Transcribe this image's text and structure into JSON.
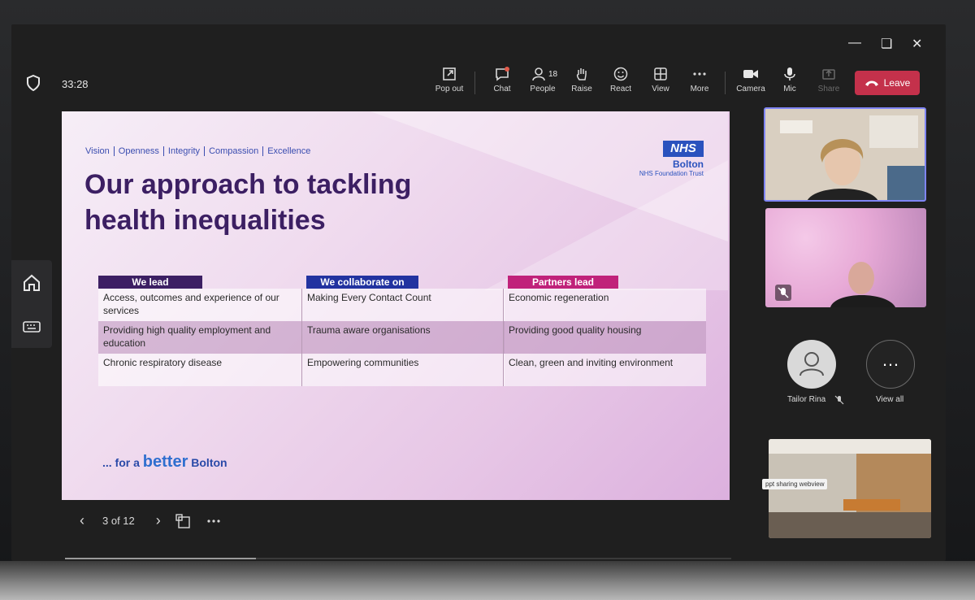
{
  "meeting": {
    "timer": "33:28",
    "toolbar": {
      "popout": "Pop out",
      "chat": "Chat",
      "people": "People",
      "people_count": "18",
      "raise": "Raise",
      "react": "React",
      "view": "View",
      "more": "More",
      "camera": "Camera",
      "mic": "Mic",
      "share": "Share",
      "leave": "Leave"
    },
    "colors": {
      "leave": "#c4314b",
      "accent": "#7f85f5"
    }
  },
  "slide": {
    "values": [
      "Vision",
      "Openness",
      "Integrity",
      "Compassion",
      "Excellence"
    ],
    "title_line1": "Our approach to tackling",
    "title_line2": "health inequalities",
    "nhs_logo": "NHS",
    "nhs_name": "Bolton",
    "nhs_trust": "NHS Foundation Trust",
    "columns": [
      {
        "header": "We lead",
        "color": "#3c1f63",
        "items": [
          "Access, outcomes and experience of our services",
          "Providing high quality employment and education",
          "Chronic respiratory disease"
        ]
      },
      {
        "header": "We collaborate on",
        "color": "#2233a0",
        "items": [
          "Making Every Contact Count",
          "Trauma aware organisations",
          "Empowering communities"
        ]
      },
      {
        "header": "Partners lead",
        "color": "#c0227a",
        "items": [
          "Economic regeneration",
          "Providing good quality housing",
          "Clean, green and inviting environment"
        ]
      }
    ],
    "tagline_pre": "... for a ",
    "tagline_better": "better",
    "tagline_post": " Bolton"
  },
  "slide_nav": {
    "counter": "3 of 12"
  },
  "participants": {
    "avatar_name": "Tailor Rina",
    "view_all": "View all",
    "tooltip": "ppt sharing webview"
  }
}
